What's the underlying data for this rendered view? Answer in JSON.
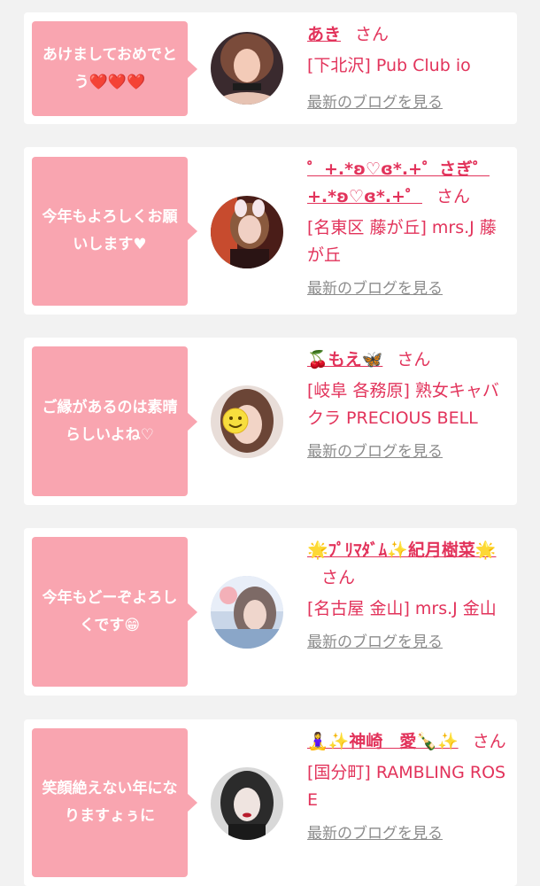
{
  "entries": [
    {
      "message": "あけましておめでとう❤️❤️❤️",
      "name": "あき",
      "honorific": "さん",
      "shop": "[下北沢] Pub Club io",
      "blog_link": "最新のブログを見る"
    },
    {
      "message": "今年もよろしくお願いします♥",
      "name": "゜+.*ʚ♡ɞ*.+゜さぎ゜+.*ʚ♡ɞ*.+゜",
      "honorific": "さん",
      "shop": "[名東区 藤が丘] mrs.J 藤が丘",
      "blog_link": "最新のブログを見る"
    },
    {
      "message": "ご縁があるのは素晴らしいよね♡",
      "name": "🍒もえ🦋",
      "honorific": "さん",
      "shop": "[岐阜 各務原] 熟女キャバクラ PRECIOUS BELL",
      "blog_link": "最新のブログを見る"
    },
    {
      "message": "今年もどーぞよろしくです😁",
      "name": "🌟ﾌﾟﾘﾏﾀﾞﾑ✨紀月樹菜🌟",
      "honorific": "さん",
      "shop": "[名古屋 金山] mrs.J 金山",
      "blog_link": "最新のブログを見る"
    },
    {
      "message": "笑顔絶えない年になりますょぅに",
      "name": "🧘‍♀️✨神崎　愛🍾✨",
      "honorific": "さん",
      "shop": "[国分町] RAMBLING ROSE",
      "blog_link": "最新のブログを見る"
    }
  ],
  "colors": {
    "accent": "#e2335b",
    "bubble": "#f9a5b0",
    "link_gray": "#8c8c8c",
    "background": "#f2f2f2"
  }
}
